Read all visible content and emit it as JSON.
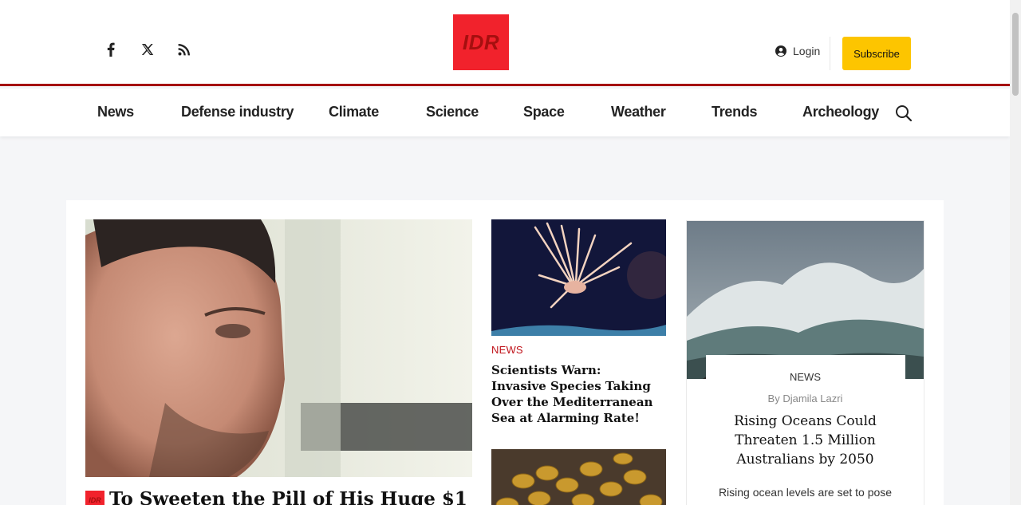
{
  "header": {
    "logo_text": "IDR",
    "login_label": "Login",
    "subscribe_label": "Subscribe",
    "social_icons": [
      "facebook-icon",
      "x-icon",
      "rss-icon"
    ],
    "accent_color": "#a50f0f",
    "logo_bg_color": "#f1222c",
    "subscribe_color": "#fdc500"
  },
  "nav": {
    "items": [
      "News",
      "Defense industry",
      "Climate",
      "Science",
      "Space",
      "Weather",
      "Trends",
      "Archeology"
    ],
    "search_icon": "search-icon"
  },
  "hero": {
    "badge_text": "IDR",
    "title": "To Sweeten the Pill of His Huge $1"
  },
  "middle": {
    "category": "NEWS",
    "title": "Scientists Warn: Invasive Species Taking Over the Mediterranean Sea at Alarming Rate!"
  },
  "right": {
    "category": "NEWS",
    "author": "By Djamila Lazri",
    "title": "Rising Oceans Could Threaten 1.5 Million Australians by 2050",
    "excerpt": "Rising ocean levels are set to pose"
  }
}
